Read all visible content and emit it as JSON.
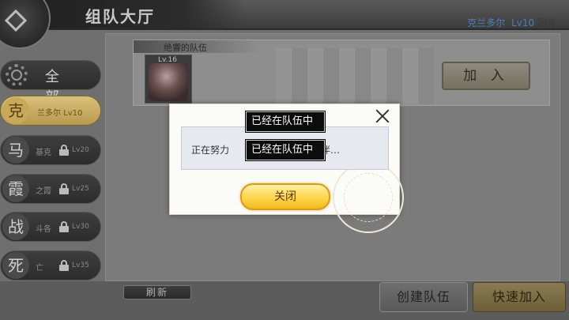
{
  "header": {
    "title": "组队大厅",
    "player_name": "克兰多尔",
    "player_level": "Lv10",
    "difficulty": "困难"
  },
  "sidebar": {
    "items": [
      {
        "glyph": "",
        "label": "全 部",
        "level": ""
      },
      {
        "glyph": "克",
        "label": "兰多尔",
        "level": "Lv10"
      },
      {
        "glyph": "马",
        "label": "基克",
        "level": "Lv20"
      },
      {
        "glyph": "霞",
        "label": "之霞",
        "level": "Lv25"
      },
      {
        "glyph": "战",
        "label": "斗各",
        "level": "Lv30"
      },
      {
        "glyph": "死",
        "label": "亡",
        "level": "Lv35"
      }
    ]
  },
  "team": {
    "name": "绝響的队伍",
    "member_level": "Lv.16",
    "join_label": "加 入"
  },
  "bottom": {
    "refresh_label": "刷新",
    "create_label": "创建队伍",
    "quick_join_label": "快速加入"
  },
  "modal": {
    "message_prefix": "正在努力",
    "message_suffix": "小伙伴…",
    "close_label": "关闭"
  },
  "toasts": [
    "已经在队伍中",
    "已经在队伍中"
  ]
}
